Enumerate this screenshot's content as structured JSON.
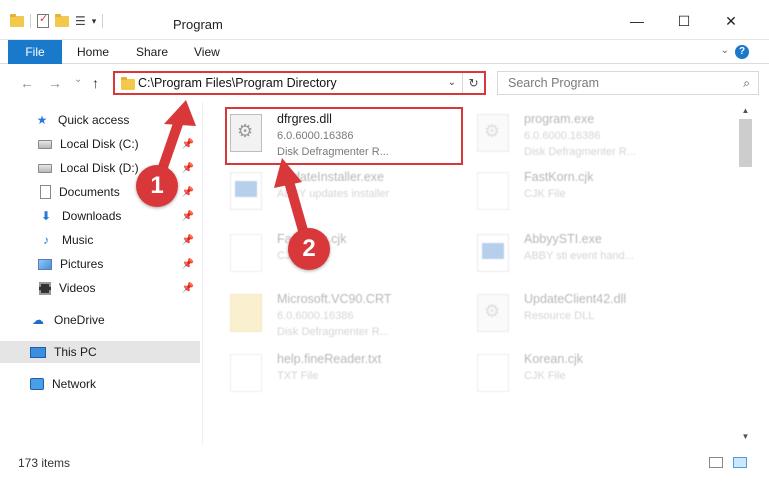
{
  "titlebar": {
    "title": "Program",
    "minimize": "—",
    "maximize": "☐",
    "close": "✕"
  },
  "ribbon": {
    "tabs": [
      "File",
      "Home",
      "Share",
      "View"
    ],
    "help": "?"
  },
  "nav": {
    "back": "←",
    "forward": "→",
    "recent": "⌄",
    "up": "↑",
    "address": "C:\\Program Files\\Program Directory",
    "search_placeholder": "Search Program"
  },
  "sidebar": {
    "items": [
      {
        "label": "Quick access",
        "icon": "star-icon"
      },
      {
        "label": "Local Disk (C:)",
        "icon": "disk-icon",
        "pinned": true
      },
      {
        "label": "Local Disk (D:)",
        "icon": "disk-icon",
        "pinned": true
      },
      {
        "label": "Documents",
        "icon": "documents-icon",
        "pinned": true
      },
      {
        "label": "Downloads",
        "icon": "download-icon",
        "pinned": true
      },
      {
        "label": "Music",
        "icon": "music-icon",
        "pinned": true
      },
      {
        "label": "Pictures",
        "icon": "pictures-icon",
        "pinned": true
      },
      {
        "label": "Videos",
        "icon": "videos-icon",
        "pinned": true
      },
      {
        "label": "OneDrive",
        "icon": "cloud-icon"
      },
      {
        "label": "This PC",
        "icon": "computer-icon",
        "selected": true
      },
      {
        "label": "Network",
        "icon": "network-icon"
      }
    ]
  },
  "files": [
    {
      "name": "dfrgres.dll",
      "line2": "6.0.6000.16386",
      "line3": "Disk Defragmenter R...",
      "icon": "dll",
      "highlight": true
    },
    {
      "name": "program.exe",
      "line2": "6.0.6000.16386",
      "line3": "Disk Defragmenter R...",
      "icon": "dll"
    },
    {
      "name": "UpdateInstaller.exe",
      "line2": "ABBY updates installer",
      "line3": "",
      "icon": "exe"
    },
    {
      "name": "FastKorn.cjk",
      "line2": "CJK File",
      "line3": "",
      "icon": "blank"
    },
    {
      "name": "FastKorn.cjk",
      "line2": "CJK File",
      "line3": "",
      "icon": "blank"
    },
    {
      "name": "AbbyySTI.exe",
      "line2": "ABBY sti event hand...",
      "line3": "",
      "icon": "exe"
    },
    {
      "name": "Microsoft.VC90.CRT",
      "line2": "6.0.6000.16386",
      "line3": "Disk Defragmenter R...",
      "icon": "folder"
    },
    {
      "name": "UpdateClient42.dll",
      "line2": "Resource DLL",
      "line3": "",
      "icon": "dll"
    },
    {
      "name": "help.fineReader.txt",
      "line2": "TXT File",
      "line3": "",
      "icon": "blank"
    },
    {
      "name": "Korean.cjk",
      "line2": "CJK File",
      "line3": "",
      "icon": "blank"
    }
  ],
  "status": {
    "count": "173 items"
  },
  "annotations": {
    "badge1": "1",
    "badge2": "2",
    "color": "#d9383a"
  }
}
